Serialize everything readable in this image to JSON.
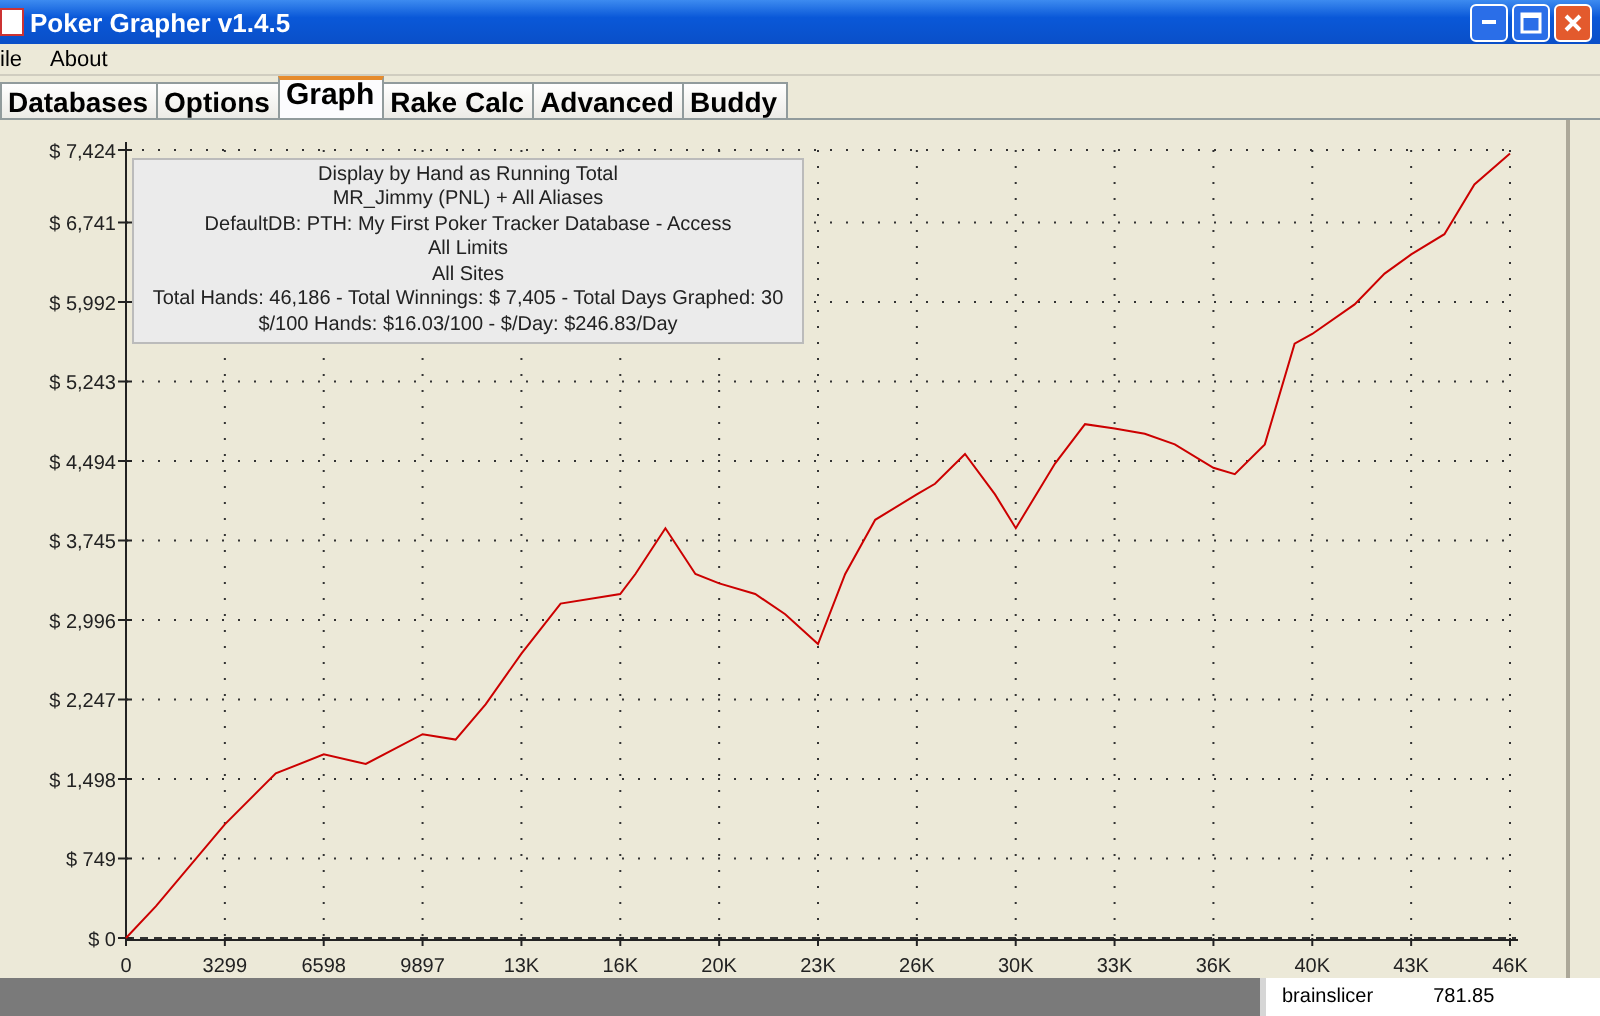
{
  "window": {
    "title": "Poker Grapher v1.4.5"
  },
  "menu": [
    {
      "label": "ile"
    },
    {
      "label": "About"
    }
  ],
  "tabs": [
    {
      "label": "Databases",
      "selected": false
    },
    {
      "label": "Options",
      "selected": false
    },
    {
      "label": "Graph",
      "selected": true
    },
    {
      "label": "Rake Calc",
      "selected": false
    },
    {
      "label": "Advanced",
      "selected": false
    },
    {
      "label": "Buddy",
      "selected": false
    }
  ],
  "graph": {
    "info_lines": [
      "Display by Hand as Running Total",
      "MR_Jimmy (PNL) + All Aliases",
      "DefaultDB: PTH: My First Poker Tracker Database - Access",
      "All Limits",
      "All Sites",
      "Total Hands: 46,186 - Total Winnings: $ 7,405 - Total Days Graphed: 30",
      "$/100 Hands: $16.03/100 - $/Day: $246.83/Day"
    ],
    "chart_data": {
      "type": "line",
      "grid": true,
      "xlim": [
        0,
        46186
      ],
      "ylim": [
        0,
        7424
      ],
      "xticks": [
        {
          "value": 0,
          "label": "0"
        },
        {
          "value": 3299,
          "label": "3299"
        },
        {
          "value": 6598,
          "label": "6598"
        },
        {
          "value": 9897,
          "label": "9897"
        },
        {
          "value": 13196,
          "label": "13K"
        },
        {
          "value": 16495,
          "label": "16K"
        },
        {
          "value": 19794,
          "label": "20K"
        },
        {
          "value": 23093,
          "label": "23K"
        },
        {
          "value": 26392,
          "label": "26K"
        },
        {
          "value": 29691,
          "label": "30K"
        },
        {
          "value": 32990,
          "label": "33K"
        },
        {
          "value": 36289,
          "label": "36K"
        },
        {
          "value": 39588,
          "label": "40K"
        },
        {
          "value": 42887,
          "label": "43K"
        },
        {
          "value": 46186,
          "label": "46K"
        }
      ],
      "yticks": [
        {
          "value": 0,
          "label": "$ 0"
        },
        {
          "value": 749,
          "label": "$ 749"
        },
        {
          "value": 1498,
          "label": "$ 1,498"
        },
        {
          "value": 2247,
          "label": "$ 2,247"
        },
        {
          "value": 2996,
          "label": "$ 2,996"
        },
        {
          "value": 3745,
          "label": "$ 3,745"
        },
        {
          "value": 4494,
          "label": "$ 4,494"
        },
        {
          "value": 5243,
          "label": "$ 5,243"
        },
        {
          "value": 5992,
          "label": "$ 5,992"
        },
        {
          "value": 6741,
          "label": "$ 6,741"
        },
        {
          "value": 7424,
          "label": "$ 7,424"
        }
      ],
      "x": [
        0,
        1000,
        3299,
        5000,
        6598,
        8000,
        9897,
        11000,
        12000,
        13196,
        14500,
        16495,
        17000,
        18000,
        19000,
        19794,
        21000,
        22000,
        23093,
        24000,
        25000,
        26392,
        27000,
        28000,
        29000,
        29691,
        31000,
        32000,
        32990,
        34000,
        35000,
        36289,
        37000,
        38000,
        39000,
        39588,
        41000,
        42000,
        42887,
        44000,
        45000,
        46186
      ],
      "series": [
        {
          "color": "#cc0000",
          "values": [
            0,
            300,
            1070,
            1550,
            1730,
            1640,
            1920,
            1870,
            2200,
            2680,
            3150,
            3240,
            3430,
            3860,
            3430,
            3340,
            3240,
            3050,
            2770,
            3430,
            3940,
            4180,
            4280,
            4560,
            4180,
            3860,
            4470,
            4840,
            4800,
            4750,
            4650,
            4430,
            4370,
            4650,
            5600,
            5690,
            5970,
            6260,
            6440,
            6630,
            7100,
            7390
          ]
        }
      ]
    }
  },
  "background_window": {
    "name": "brainslicer",
    "value": "781.85"
  }
}
